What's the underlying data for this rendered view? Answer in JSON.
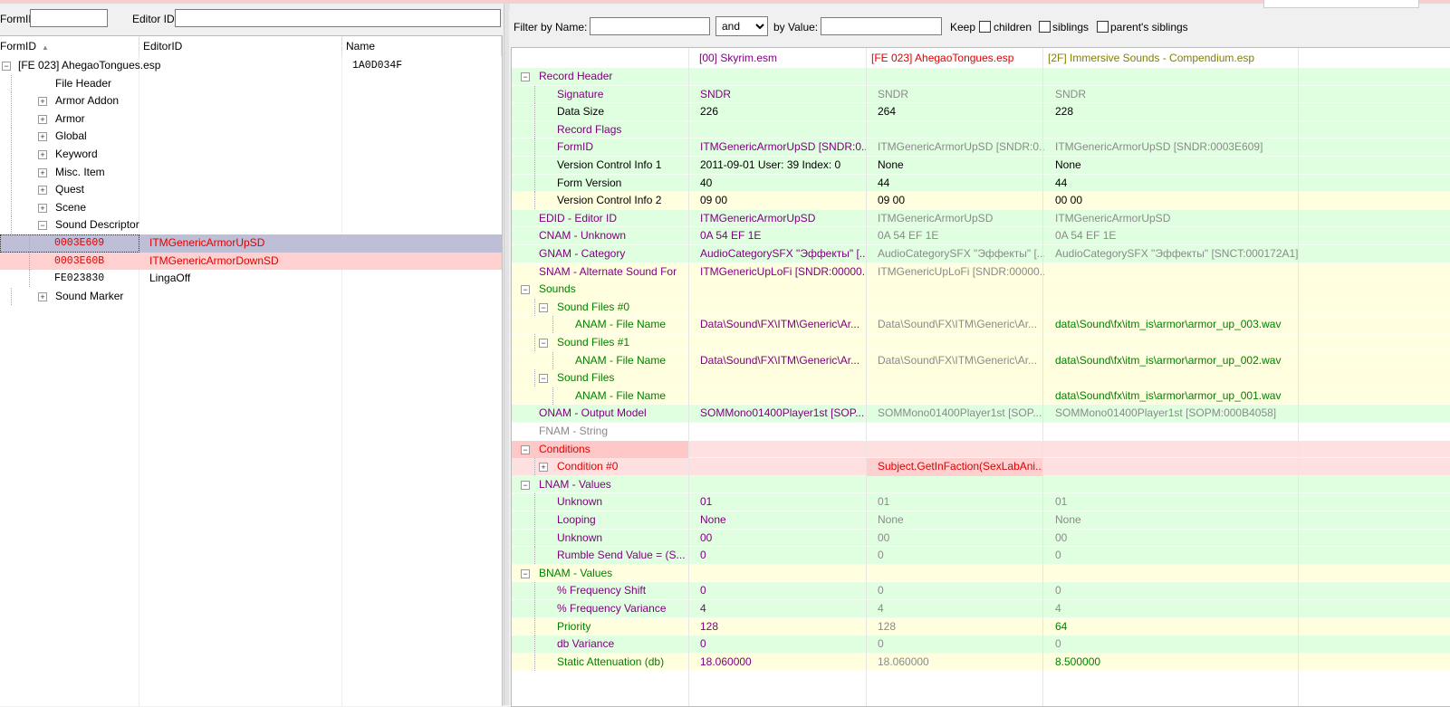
{
  "left": {
    "formid_label": "FormID",
    "editorid_label": "Editor ID",
    "formid_value": "",
    "editorid_value": "",
    "columns": [
      "FormID",
      "EditorID",
      "Name"
    ],
    "tree": [
      {
        "label": "[FE 023] AhegaoTongues.esp",
        "name": "1A0D034F",
        "indent": 0,
        "expander": "−"
      },
      {
        "label": "File Header",
        "indent": 1,
        "expander": ""
      },
      {
        "label": "Armor Addon",
        "indent": 1,
        "expander": "+"
      },
      {
        "label": "Armor",
        "indent": 1,
        "expander": "+"
      },
      {
        "label": "Global",
        "indent": 1,
        "expander": "+"
      },
      {
        "label": "Keyword",
        "indent": 1,
        "expander": "+"
      },
      {
        "label": "Misc. Item",
        "indent": 1,
        "expander": "+"
      },
      {
        "label": "Quest",
        "indent": 1,
        "expander": "+"
      },
      {
        "label": "Scene",
        "indent": 1,
        "expander": "+"
      },
      {
        "label": "Sound Descriptor",
        "indent": 1,
        "expander": "−"
      },
      {
        "formid": "0003E609",
        "editorid": "ITMGenericArmorUpSD",
        "indent": 2,
        "style": "selected"
      },
      {
        "formid": "0003E60B",
        "editorid": "ITMGenericArmorDownSD",
        "indent": 2,
        "style": "conflict"
      },
      {
        "formid": "FE023830",
        "editorid": "LingaOff",
        "indent": 2,
        "style": "normal"
      },
      {
        "label": "Sound Marker",
        "indent": 1,
        "expander": "+"
      }
    ]
  },
  "filter": {
    "by_name_label": "Filter by Name:",
    "name_value": "",
    "operator": "and",
    "by_value_label": "by Value:",
    "value_value": "",
    "keep_label": "Keep",
    "children_label": "children",
    "siblings_label": "siblings",
    "parents_siblings_label": "parent's siblings"
  },
  "grid": {
    "headers": [
      "[00] Skyrim.esm",
      "[FE 023] AhegaoTongues.esp",
      "[2F] Immersive Sounds - Compendium.esp"
    ],
    "rows": [
      {
        "label": "Record Header",
        "lvl": 0,
        "exp": "−",
        "bg": "green",
        "lc": "purple",
        "v": [
          "",
          "",
          ""
        ],
        "vc": [
          "purple",
          "gray",
          "gray"
        ]
      },
      {
        "label": "Signature",
        "lvl": 1,
        "exp": "",
        "bg": "green",
        "lc": "purple",
        "v": [
          "SNDR",
          "SNDR",
          "SNDR"
        ],
        "vc": [
          "purple",
          "gray",
          "gray"
        ]
      },
      {
        "label": "Data Size",
        "lvl": 1,
        "exp": "",
        "bg": "green",
        "lc": "black",
        "v": [
          "226",
          "264",
          "228"
        ],
        "vc": [
          "black",
          "black",
          "black"
        ]
      },
      {
        "label": "Record Flags",
        "lvl": 1,
        "exp": "",
        "bg": "green",
        "lc": "purple",
        "v": [
          "",
          "",
          ""
        ],
        "vc": [
          "purple",
          "gray",
          "gray"
        ]
      },
      {
        "label": "FormID",
        "lvl": 1,
        "exp": "",
        "bg": "green",
        "lc": "purple",
        "v": [
          "ITMGenericArmorUpSD [SNDR:0...",
          "ITMGenericArmorUpSD [SNDR:0...",
          "ITMGenericArmorUpSD [SNDR:0003E609]"
        ],
        "vc": [
          "purple",
          "gray",
          "gray"
        ]
      },
      {
        "label": "Version Control Info 1",
        "lvl": 1,
        "exp": "",
        "bg": "green",
        "lc": "black",
        "v": [
          "2011-09-01 User: 39 Index: 0",
          "None",
          "None"
        ],
        "vc": [
          "black",
          "black",
          "black"
        ]
      },
      {
        "label": "Form Version",
        "lvl": 1,
        "exp": "",
        "bg": "green",
        "lc": "black",
        "v": [
          "40",
          "44",
          "44"
        ],
        "vc": [
          "black",
          "black",
          "black"
        ]
      },
      {
        "label": "Version Control Info 2",
        "lvl": 1,
        "exp": "",
        "bg": "yellow",
        "lc": "black",
        "v": [
          "09 00",
          "09 00",
          "00 00"
        ],
        "vc": [
          "black",
          "black",
          "black"
        ]
      },
      {
        "label": "EDID - Editor ID",
        "lvl": 0,
        "exp": "",
        "bg": "green",
        "lc": "purple",
        "v": [
          "ITMGenericArmorUpSD",
          "ITMGenericArmorUpSD",
          "ITMGenericArmorUpSD"
        ],
        "vc": [
          "purple",
          "gray",
          "gray"
        ]
      },
      {
        "label": "CNAM - Unknown",
        "lvl": 0,
        "exp": "",
        "bg": "green",
        "lc": "purple",
        "v": [
          "0A 54 EF 1E",
          "0A 54 EF 1E",
          "0A 54 EF 1E"
        ],
        "vc": [
          "purple",
          "gray",
          "gray"
        ]
      },
      {
        "label": "GNAM - Category",
        "lvl": 0,
        "exp": "",
        "bg": "green",
        "lc": "purple",
        "v": [
          "AudioCategorySFX \"Эффекты\" [...",
          "AudioCategorySFX \"Эффекты\" [...",
          "AudioCategorySFX \"Эффекты\" [SNCT:000172A1]"
        ],
        "vc": [
          "purple",
          "gray",
          "gray"
        ]
      },
      {
        "label": "SNAM - Alternate Sound For",
        "lvl": 0,
        "exp": "",
        "bg": "yellow",
        "lc": "purple",
        "v": [
          "ITMGenericUpLoFi [SNDR:00000...",
          "ITMGenericUpLoFi [SNDR:00000...",
          ""
        ],
        "vc": [
          "purple",
          "gray",
          "gray"
        ]
      },
      {
        "label": "Sounds",
        "lvl": 0,
        "exp": "−",
        "bg": "yellow",
        "lc": "green",
        "v": [
          "",
          "",
          ""
        ],
        "vc": [
          "green",
          "gray",
          "green"
        ]
      },
      {
        "label": "Sound Files #0",
        "lvl": 1,
        "exp": "−",
        "bg": "yellow",
        "lc": "green",
        "v": [
          "",
          "",
          ""
        ],
        "vc": [
          "green",
          "gray",
          "green"
        ]
      },
      {
        "label": "ANAM - File Name",
        "lvl": 2,
        "exp": "",
        "bg": "yellow",
        "lc": "green",
        "v": [
          "Data\\Sound\\FX\\ITM\\Generic\\Ar...",
          "Data\\Sound\\FX\\ITM\\Generic\\Ar...",
          "data\\Sound\\fx\\itm_is\\armor\\armor_up_003.wav"
        ],
        "vc": [
          "purple",
          "gray",
          "green"
        ]
      },
      {
        "label": "Sound Files #1",
        "lvl": 1,
        "exp": "−",
        "bg": "yellow",
        "lc": "green",
        "v": [
          "",
          "",
          ""
        ],
        "vc": [
          "green",
          "gray",
          "green"
        ]
      },
      {
        "label": "ANAM - File Name",
        "lvl": 2,
        "exp": "",
        "bg": "yellow",
        "lc": "green",
        "v": [
          "Data\\Sound\\FX\\ITM\\Generic\\Ar...",
          "Data\\Sound\\FX\\ITM\\Generic\\Ar...",
          "data\\Sound\\fx\\itm_is\\armor\\armor_up_002.wav"
        ],
        "vc": [
          "purple",
          "gray",
          "green"
        ]
      },
      {
        "label": "Sound Files",
        "lvl": 1,
        "exp": "−",
        "bg": "yellow",
        "lc": "green",
        "v": [
          "",
          "",
          ""
        ],
        "vc": [
          "green",
          "gray",
          "green"
        ]
      },
      {
        "label": "ANAM - File Name",
        "lvl": 2,
        "exp": "",
        "bg": "yellow",
        "lc": "green",
        "v": [
          "",
          "",
          "data\\Sound\\fx\\itm_is\\armor\\armor_up_001.wav"
        ],
        "vc": [
          "purple",
          "gray",
          "green"
        ]
      },
      {
        "label": "ONAM - Output Model",
        "lvl": 0,
        "exp": "",
        "bg": "green",
        "lc": "purple",
        "v": [
          "SOMMono01400Player1st [SOP...",
          "SOMMono01400Player1st [SOP...",
          "SOMMono01400Player1st [SOPM:000B4058]"
        ],
        "vc": [
          "purple",
          "gray",
          "gray"
        ]
      },
      {
        "label": "FNAM - String",
        "lvl": 0,
        "exp": "",
        "bg": "white",
        "lc": "gray",
        "v": [
          "",
          "",
          ""
        ],
        "vc": [
          "gray",
          "gray",
          "gray"
        ]
      },
      {
        "label": "Conditions",
        "lvl": 0,
        "exp": "−",
        "bg": "pink",
        "lc": "red",
        "v": [
          "",
          "",
          ""
        ],
        "vc": [
          "red",
          "red",
          "red"
        ]
      },
      {
        "label": "Condition #0",
        "lvl": 1,
        "exp": "+",
        "bg": "pink",
        "lc": "red",
        "v": [
          "",
          "Subject.GetInFaction(SexLabAni...",
          ""
        ],
        "vc": [
          "red",
          "red",
          "red"
        ]
      },
      {
        "label": "LNAM - Values",
        "lvl": 0,
        "exp": "−",
        "bg": "green",
        "lc": "purple",
        "v": [
          "",
          "",
          ""
        ],
        "vc": [
          "purple",
          "gray",
          "gray"
        ]
      },
      {
        "label": "Unknown",
        "lvl": 1,
        "exp": "",
        "bg": "green",
        "lc": "purple",
        "v": [
          "01",
          "01",
          "01"
        ],
        "vc": [
          "purple",
          "gray",
          "gray"
        ]
      },
      {
        "label": "Looping",
        "lvl": 1,
        "exp": "",
        "bg": "green",
        "lc": "purple",
        "v": [
          "None",
          "None",
          "None"
        ],
        "vc": [
          "purple",
          "gray",
          "gray"
        ]
      },
      {
        "label": "Unknown",
        "lvl": 1,
        "exp": "",
        "bg": "green",
        "lc": "purple",
        "v": [
          "00",
          "00",
          "00"
        ],
        "vc": [
          "purple",
          "gray",
          "gray"
        ]
      },
      {
        "label": "Rumble Send Value = (S...",
        "lvl": 1,
        "exp": "",
        "bg": "green",
        "lc": "purple",
        "v": [
          "0",
          "0",
          "0"
        ],
        "vc": [
          "purple",
          "gray",
          "gray"
        ]
      },
      {
        "label": "BNAM - Values",
        "lvl": 0,
        "exp": "−",
        "bg": "yellow",
        "lc": "green",
        "v": [
          "",
          "",
          ""
        ],
        "vc": [
          "green",
          "gray",
          "green"
        ]
      },
      {
        "label": "% Frequency Shift",
        "lvl": 1,
        "exp": "",
        "bg": "green",
        "lc": "purple",
        "v": [
          "0",
          "0",
          "0"
        ],
        "vc": [
          "purple",
          "gray",
          "gray"
        ]
      },
      {
        "label": "% Frequency Variance",
        "lvl": 1,
        "exp": "",
        "bg": "green",
        "lc": "purple",
        "v": [
          "4",
          "4",
          "4"
        ],
        "vc": [
          "purple",
          "gray",
          "gray"
        ]
      },
      {
        "label": "Priority",
        "lvl": 1,
        "exp": "",
        "bg": "yellow",
        "lc": "green",
        "v": [
          "128",
          "128",
          "64"
        ],
        "vc": [
          "purple",
          "gray",
          "green"
        ]
      },
      {
        "label": "db Variance",
        "lvl": 1,
        "exp": "",
        "bg": "green",
        "lc": "purple",
        "v": [
          "0",
          "0",
          "0"
        ],
        "vc": [
          "purple",
          "gray",
          "gray"
        ]
      },
      {
        "label": "Static Attenuation (db)",
        "lvl": 1,
        "exp": "",
        "bg": "yellow",
        "lc": "green",
        "v": [
          "18.060000",
          "18.060000",
          "8.500000"
        ],
        "vc": [
          "purple",
          "gray",
          "green"
        ]
      }
    ]
  },
  "colors": {
    "green_bg": "#e0ffe0",
    "yellow_bg": "#ffffe0",
    "pink_bg": "#ffe0e0",
    "selected_bg": "#bebed7",
    "conflict_bg": "#ffd0d0",
    "header_black": "#800080",
    "header_red": "#ff0000",
    "header_olive": "#808000"
  }
}
